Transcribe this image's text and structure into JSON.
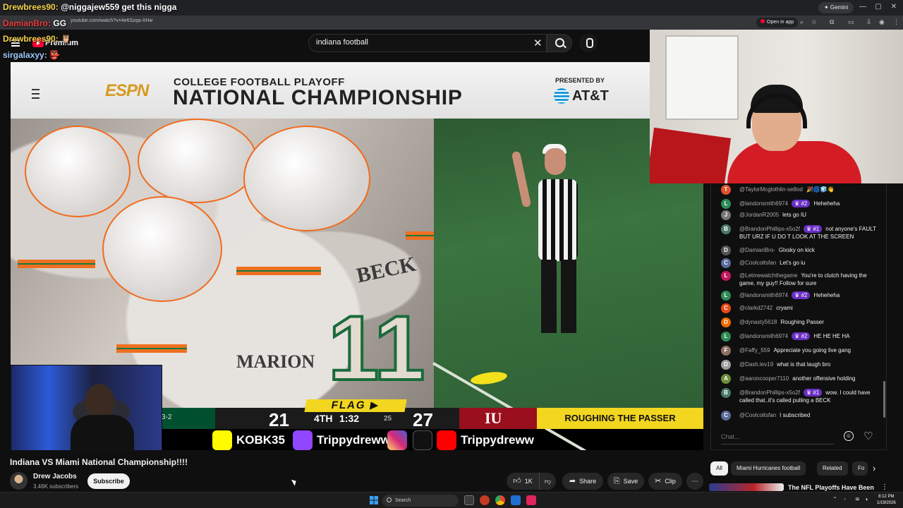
{
  "browser": {
    "url": "youtube.com/watch?v=4e6Szqa-XHw",
    "gemini_label": "✦ Gemini",
    "open_in_app_label": "Open in app"
  },
  "overlay_chat": [
    {
      "user": "Drewbrees90:",
      "message": "@niggajew559 get this nigga"
    },
    {
      "user": "DamianBro:",
      "message": "GG"
    },
    {
      "user": "Drewbrees90:",
      "message": "🦉"
    },
    {
      "user": "sirgalaxyy:",
      "message": "👺"
    }
  ],
  "youtube_header": {
    "premium_label": "Premium",
    "search_value": "indiana football"
  },
  "video": {
    "banner": {
      "espn": "ESPN",
      "subtitle": "COLLEGE FOOTBALL PLAYOFF",
      "title": "NATIONAL CHAMPIONSHIP",
      "presented_by": "PRESENTED BY",
      "sponsor": "AT&T"
    },
    "jersey_name_1": "BECK",
    "jersey_name_2": "MARION",
    "jersey_number": "11",
    "scoreboard": {
      "miami_record": "3-2",
      "miami_score": "21",
      "quarter": "4TH",
      "clock": "1:32",
      "play_clock": "25",
      "flag_label": "FLAG ▶",
      "indiana_score": "27",
      "indiana_logo": "IU",
      "call": "ROUGHING THE PASSER"
    },
    "socials": [
      {
        "platform": "snapchat",
        "handle": "KOBK35",
        "color": "#fffc00"
      },
      {
        "platform": "twitch",
        "handle": "Trippydrewwtv",
        "color": "#9146ff"
      },
      {
        "platform": "instagram",
        "handle": "",
        "color": "#d62976"
      },
      {
        "platform": "tiktok",
        "handle": "",
        "color": "#111111"
      },
      {
        "platform": "youtube",
        "handle": "Trippydreww",
        "color": "#ff0000"
      }
    ]
  },
  "video_info": {
    "title": "Indiana VS Miami National Championship!!!!",
    "channel_name": "Drew Jacobs",
    "subscribers": "3.46K subscribers",
    "subscribe_label": "Subscribe",
    "like_count": "1K",
    "share_label": "Share",
    "save_label": "Save",
    "clip_label": "Clip"
  },
  "live_chat": {
    "messages": [
      {
        "user": "@TaylorMcglothlin-se8od",
        "badge": "",
        "text": "🎉🌀🧊👋",
        "avatar": "T",
        "color": "#e2512f"
      },
      {
        "user": "@landonsmith6974",
        "badge": "♛ #2",
        "text": "Heheheha",
        "avatar": "L",
        "color": "#2e8b57"
      },
      {
        "user": "@JordanR2005",
        "badge": "",
        "text": "lets go IU",
        "avatar": "J",
        "color": "#777777"
      },
      {
        "user": "@BrandonPhillips-x5o2f",
        "badge": "♛ #1",
        "text": "not anyone's FAULT BUT URZ IF U DO T LOOK AT THE SCREEN",
        "avatar": "B",
        "color": "#4a7a6a"
      },
      {
        "user": "@DamianBro-",
        "badge": "",
        "text": "Glxsky on kick",
        "avatar": "D",
        "color": "#555555"
      },
      {
        "user": "@Coolcoltsfan",
        "badge": "",
        "text": "Let's go iu",
        "avatar": "C",
        "color": "#5a6a9a"
      },
      {
        "user": "@Letmewatchthegame",
        "badge": "",
        "text": "You're to clutch having the game, my guy!! Follow for sure",
        "avatar": "L",
        "color": "#c2185b"
      },
      {
        "user": "@landonsmith6974",
        "badge": "♛ #2",
        "text": "Heheheha",
        "avatar": "L",
        "color": "#2e8b57"
      },
      {
        "user": "@clarkd2742",
        "badge": "",
        "text": "cryami",
        "avatar": "C",
        "color": "#e64a19"
      },
      {
        "user": "@dynasty5618",
        "badge": "",
        "text": "Roughing Passer",
        "avatar": "D",
        "color": "#ef6c00"
      },
      {
        "user": "@landonsmith6974",
        "badge": "♛ #2",
        "text": "HE HE HE HA",
        "avatar": "L",
        "color": "#2e8b57"
      },
      {
        "user": "@Faffy_559",
        "badge": "",
        "text": "Appreciate you going live gang",
        "avatar": "F",
        "color": "#8d6e63"
      },
      {
        "user": "@Dash.lev19",
        "badge": "",
        "text": "what is that laugh bro",
        "avatar": "D",
        "color": "#9e9e9e"
      },
      {
        "user": "@aaroncooper7110",
        "badge": "",
        "text": "another offensive holding",
        "avatar": "A",
        "color": "#6d8b3a"
      },
      {
        "user": "@BrandonPhillips-x5o2f",
        "badge": "♛ #1",
        "text": "wow. I could have called that..it's called pulling a BECK",
        "avatar": "B",
        "color": "#4a7a6a"
      },
      {
        "user": "@Coolcoltsfan",
        "badge": "",
        "text": "I subscribed",
        "avatar": "C",
        "color": "#5a6a9a"
      }
    ],
    "input_placeholder": "Chat..."
  },
  "chips": [
    "All",
    "Miami Hurricanes football",
    "Related",
    "Fo"
  ],
  "related": {
    "title": "The NFL Playoffs Have Been"
  },
  "taskbar": {
    "search_placeholder": "Search",
    "time": "8:12 PM",
    "date": "1/19/2026"
  }
}
